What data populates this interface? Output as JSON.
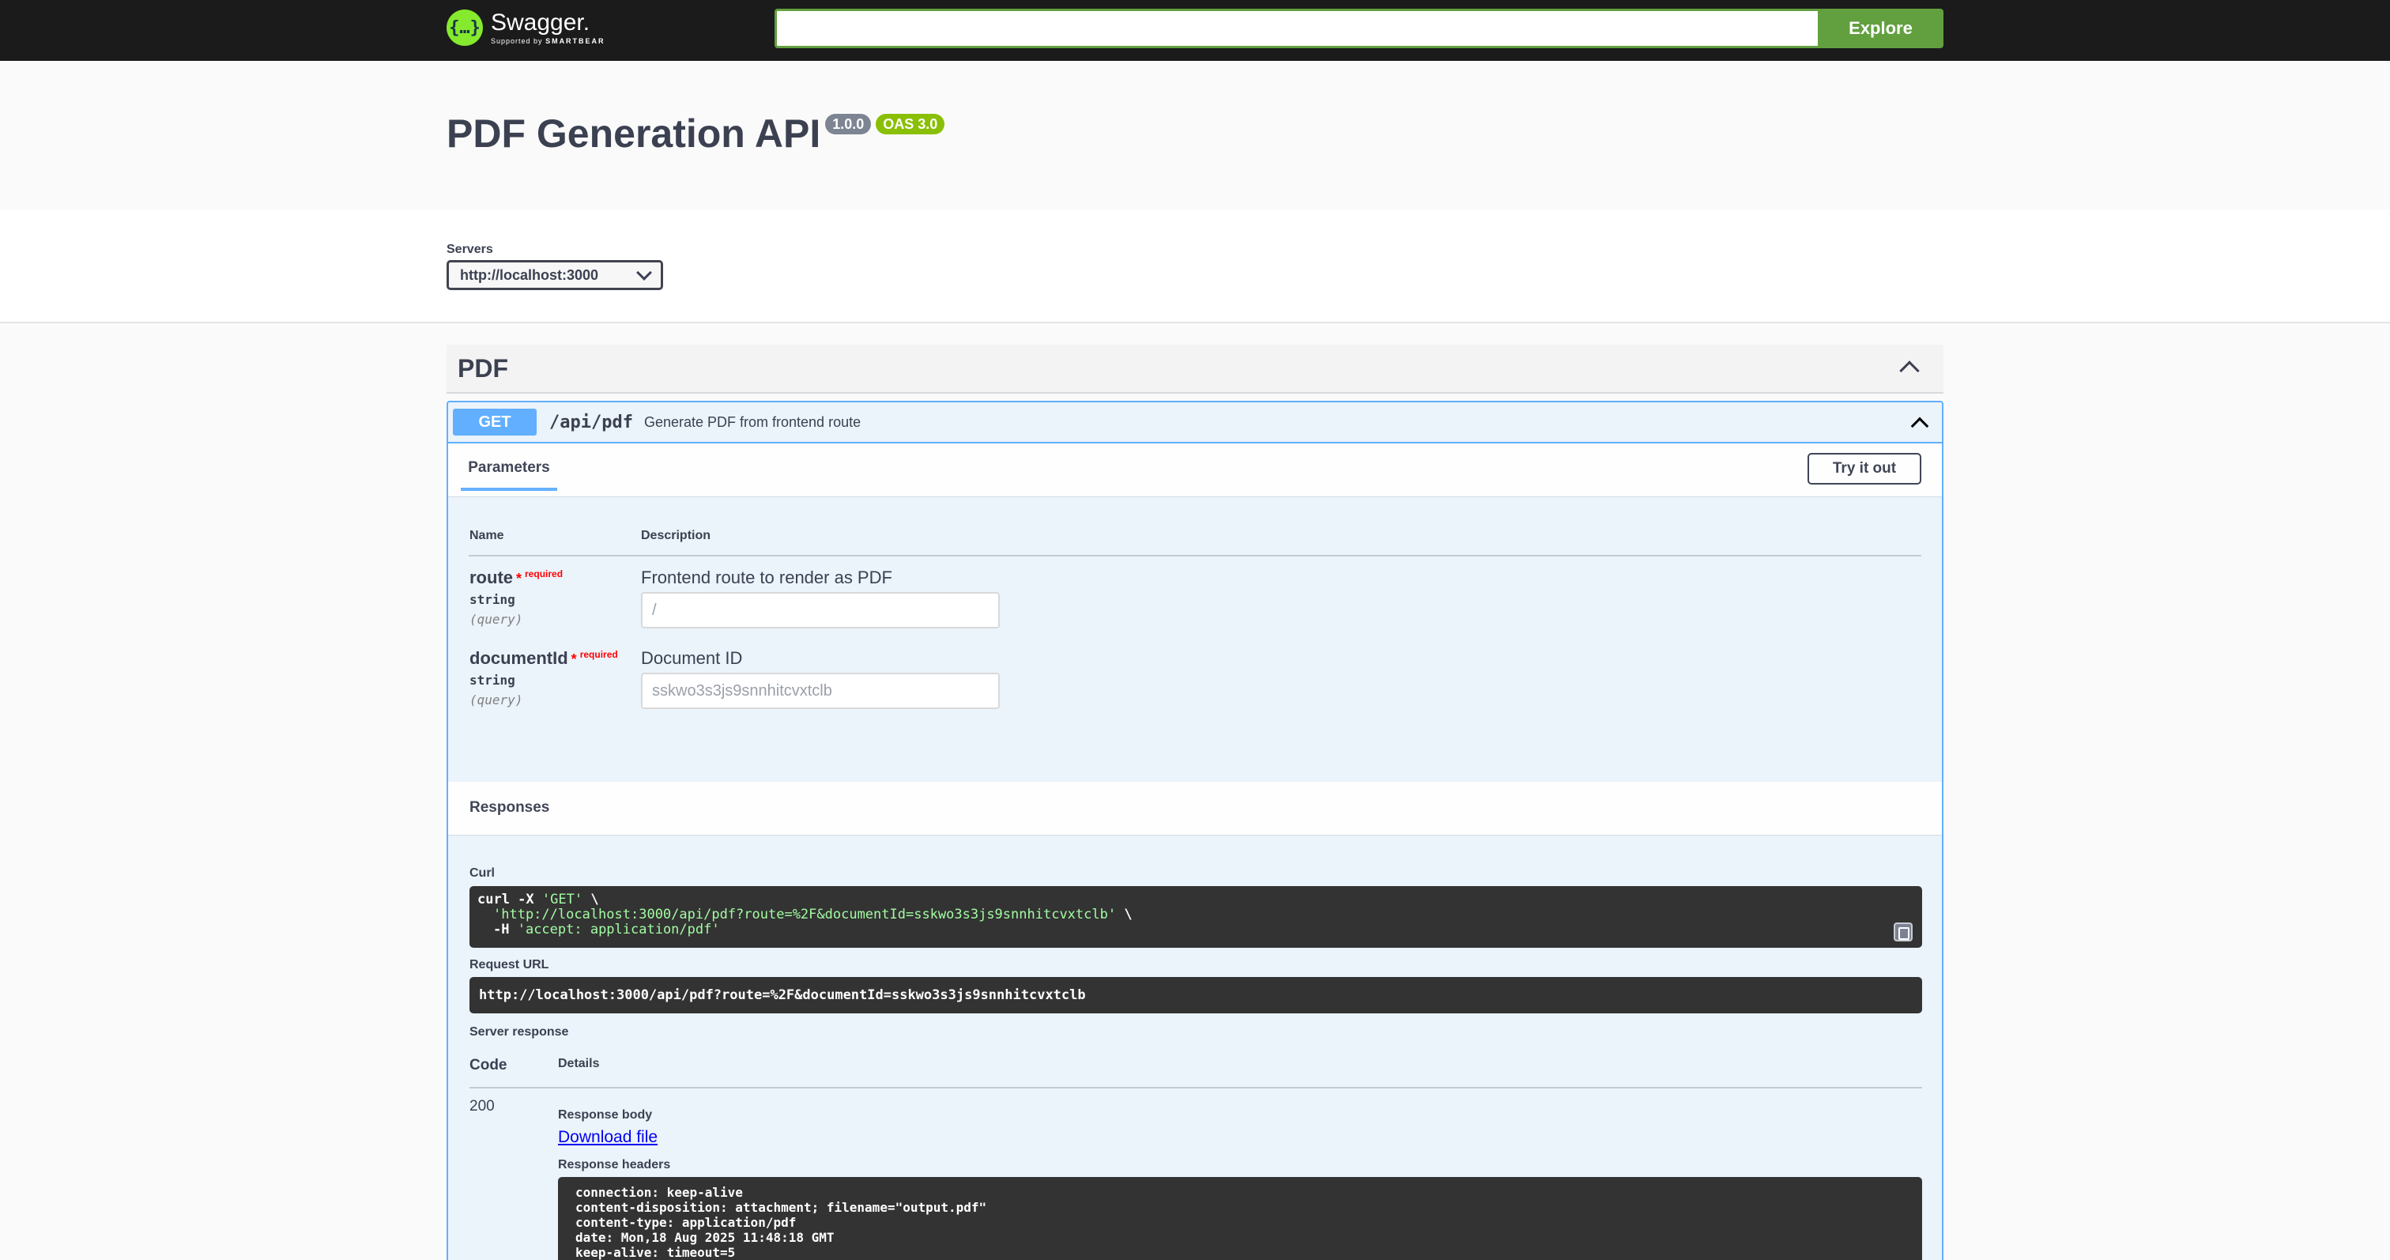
{
  "topbar": {
    "logo_title": "Swagger.",
    "logo_sub_prefix": "Supported by",
    "logo_sub_brand": "SMARTBEAR",
    "search_value": "",
    "explore_label": "Explore"
  },
  "info": {
    "title": "PDF Generation API",
    "version": "1.0.0",
    "oas": "OAS 3.0"
  },
  "servers": {
    "label": "Servers",
    "selected": "http://localhost:3000"
  },
  "tag": {
    "name": "PDF"
  },
  "operation": {
    "method": "GET",
    "path": "/api/pdf",
    "summary": "Generate PDF from frontend route",
    "tab_label": "Parameters",
    "try_label": "Try it out",
    "col_name": "Name",
    "col_description": "Description",
    "required_star": "*",
    "required_text": "required",
    "params": [
      {
        "name": "route",
        "type": "string",
        "in": "(query)",
        "description": "Frontend route to render as PDF",
        "placeholder": "/"
      },
      {
        "name": "documentId",
        "type": "string",
        "in": "(query)",
        "description": "Document ID",
        "placeholder": "sskwo3s3js9snnhitcvxtclb"
      }
    ]
  },
  "responses": {
    "title": "Responses",
    "curl_label": "Curl",
    "curl_line1_cmd": "curl -X ",
    "curl_line1_str": "'GET'",
    "curl_line1_end": " \\",
    "curl_line2_str": "'http://localhost:3000/api/pdf?route=%2F&documentId=sskwo3s3js9snnhitcvxtclb'",
    "curl_line2_end": " \\",
    "curl_line3_cmd": "-H ",
    "curl_line3_str": "'accept: application/pdf'",
    "request_url_label": "Request URL",
    "request_url": "http://localhost:3000/api/pdf?route=%2F&documentId=sskwo3s3js9snnhitcvxtclb",
    "server_response_label": "Server response",
    "code_header": "Code",
    "details_header": "Details",
    "code": "200",
    "response_body_label": "Response body",
    "download_label": "Download file",
    "response_headers_label": "Response headers",
    "headers": [
      "connection: keep-alive",
      "content-disposition: attachment; filename=\"output.pdf\"",
      "content-type: application/pdf",
      "date: Mon,18 Aug 2025 11:48:18 GMT",
      "keep-alive: timeout=5"
    ]
  }
}
